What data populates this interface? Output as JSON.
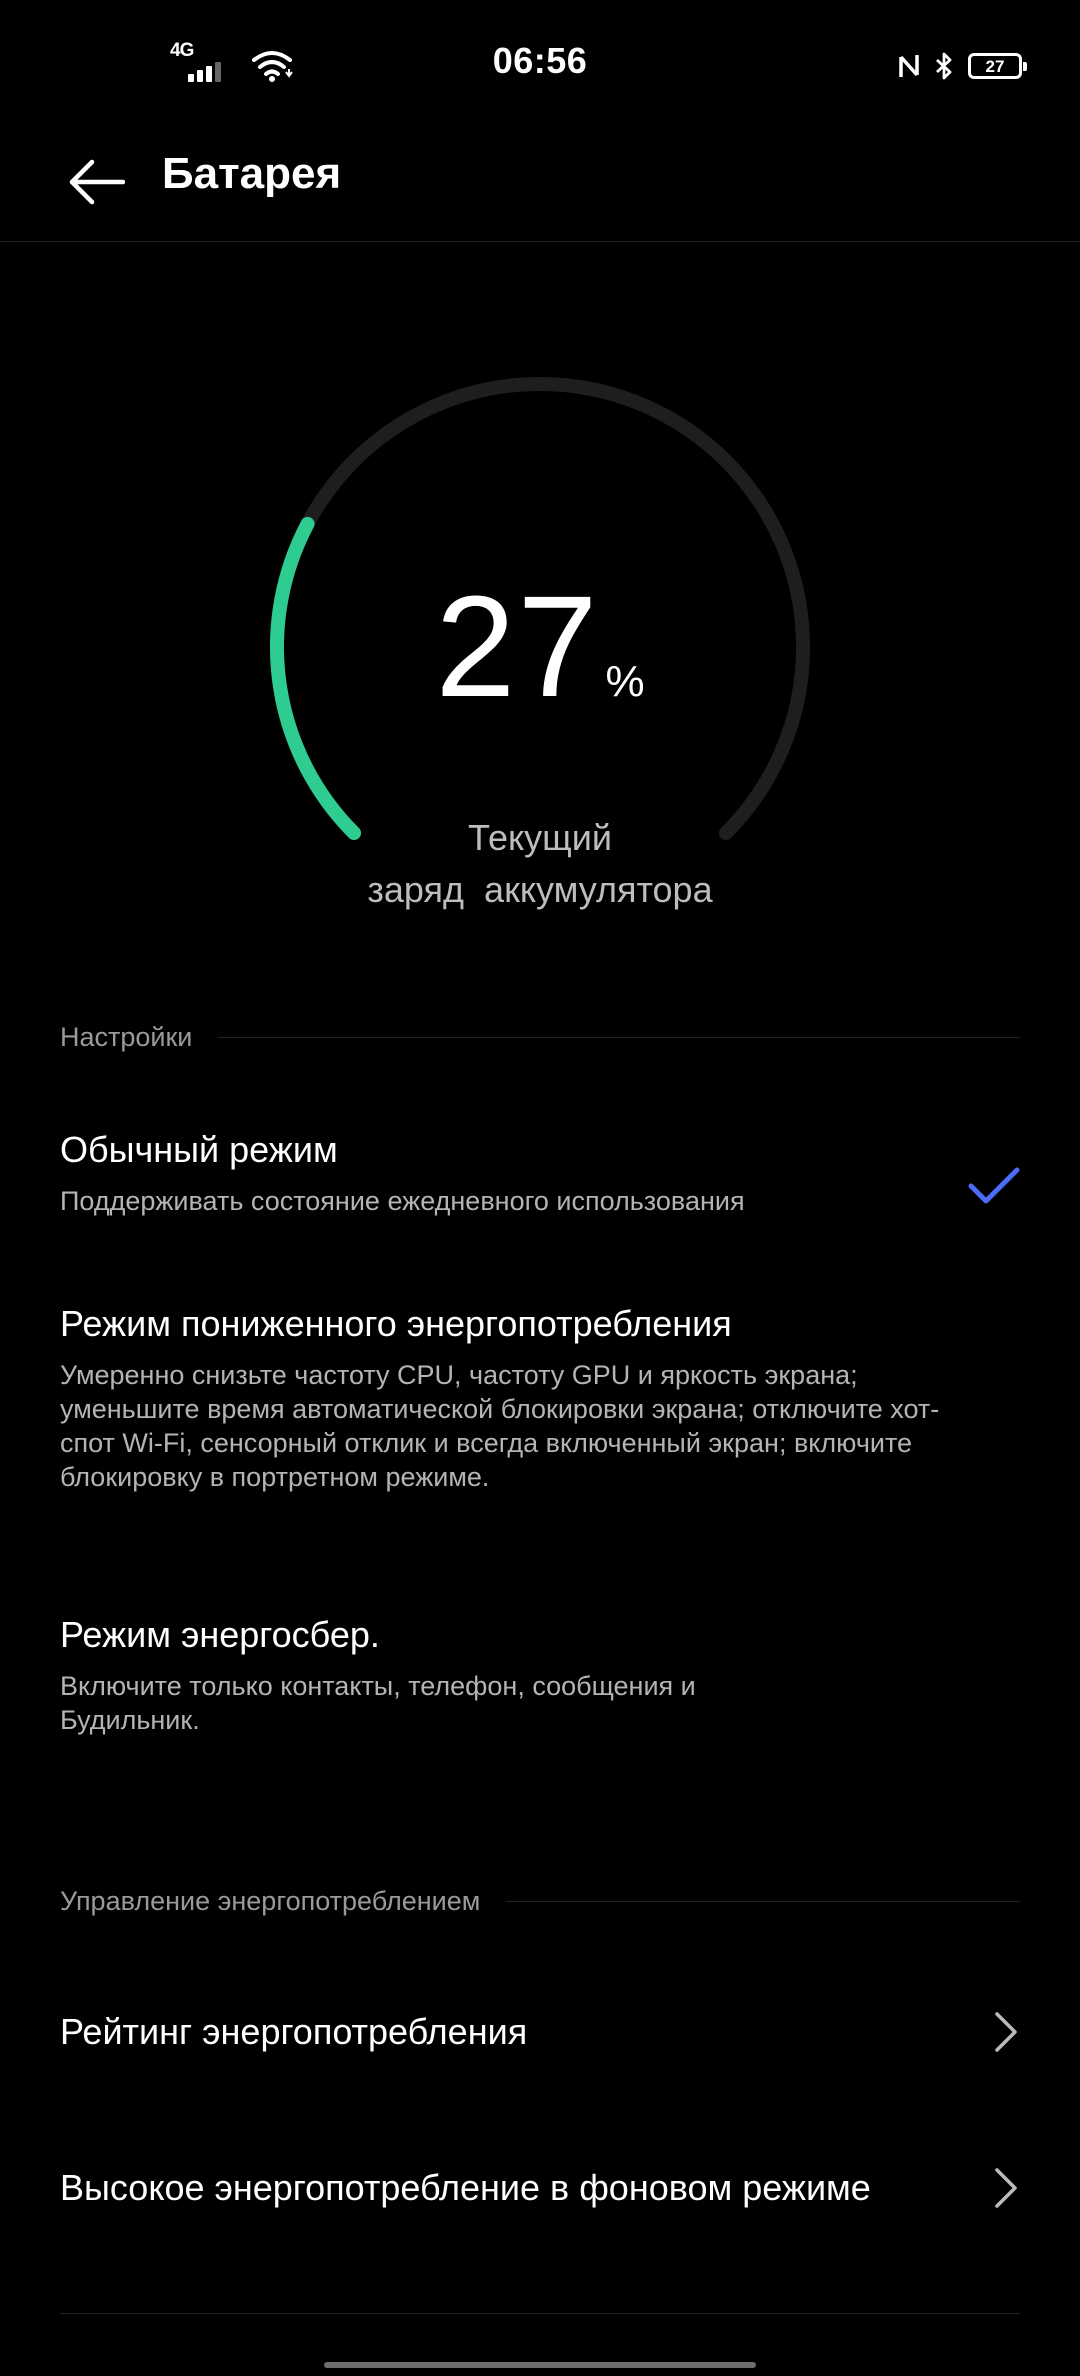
{
  "status_bar": {
    "network": "4G",
    "time": "06:56",
    "battery": "27",
    "icons": [
      "signal-icon",
      "wifi-icon",
      "nfc-icon",
      "bluetooth-icon",
      "battery-icon"
    ]
  },
  "header": {
    "title": "Батарея",
    "back_icon": "arrow-left-icon"
  },
  "gauge": {
    "value": "27",
    "unit": "%",
    "level_fraction": 0.27,
    "caption_line1": "Текущий",
    "caption_line2": "заряд  аккумулятора",
    "track_color": "#1e1e1e",
    "fill_color": "#2ecc91"
  },
  "settings_section": {
    "title": "Настройки",
    "modes": [
      {
        "title": "Обычный режим",
        "description": "Поддерживать состояние ежедневного использования",
        "selected": true
      },
      {
        "title": "Режим пониженного энергопотребления",
        "description": "Умеренно снизьте частоту CPU, частоту GPU и яркость экрана; уменьшите время автоматической блокировки экрана; отключите хот-спот Wi-Fi, сенсорный отклик и всегда включенный экран; включите блокировку в портретном режиме.",
        "selected": false
      },
      {
        "title": "Режим энергосбер.",
        "description": "Включите только контакты, телефон, сообщения и Будильник.",
        "selected": false
      }
    ],
    "check_color": "#4a6cf7"
  },
  "power_section": {
    "title": "Управление энергопотреблением",
    "items": [
      {
        "label": "Рейтинг энергопотребления"
      },
      {
        "label": "Высокое энергопотребление в фоновом режиме"
      }
    ]
  }
}
